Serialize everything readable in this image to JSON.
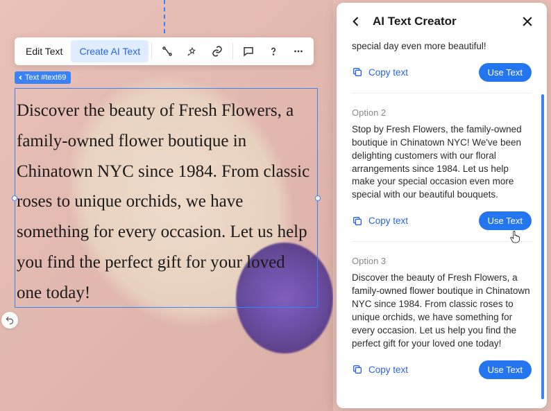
{
  "toolbar": {
    "edit_text": "Edit Text",
    "create_ai_text": "Create AI Text"
  },
  "text_chip": "Text #text69",
  "canvas_text": "Discover the beauty of Fresh Flowers, a family-owned flower boutique in Chinatown NYC since 1984. From classic roses to unique orchids, we have something for every occasion. Let us help you find the perfect gift for your loved one today!",
  "panel": {
    "title": "AI Text Creator",
    "copy_label": "Copy text",
    "use_label": "Use Text",
    "options": [
      {
        "label": "",
        "text_fragment": "special day even more beautiful!"
      },
      {
        "label": "Option 2",
        "text": "Stop by Fresh Flowers, the family-owned boutique in Chinatown NYC! We've been delighting customers with our floral arrangements since 1984. Let us help make your special occasion even more special with our beautiful bouquets."
      },
      {
        "label": "Option 3",
        "text": "Discover the beauty of Fresh Flowers, a family-owned flower boutique in Chinatown NYC since 1984. From classic roses to unique orchids, we have something for every occasion. Let us help you find the perfect gift for your loved one today!"
      }
    ]
  }
}
